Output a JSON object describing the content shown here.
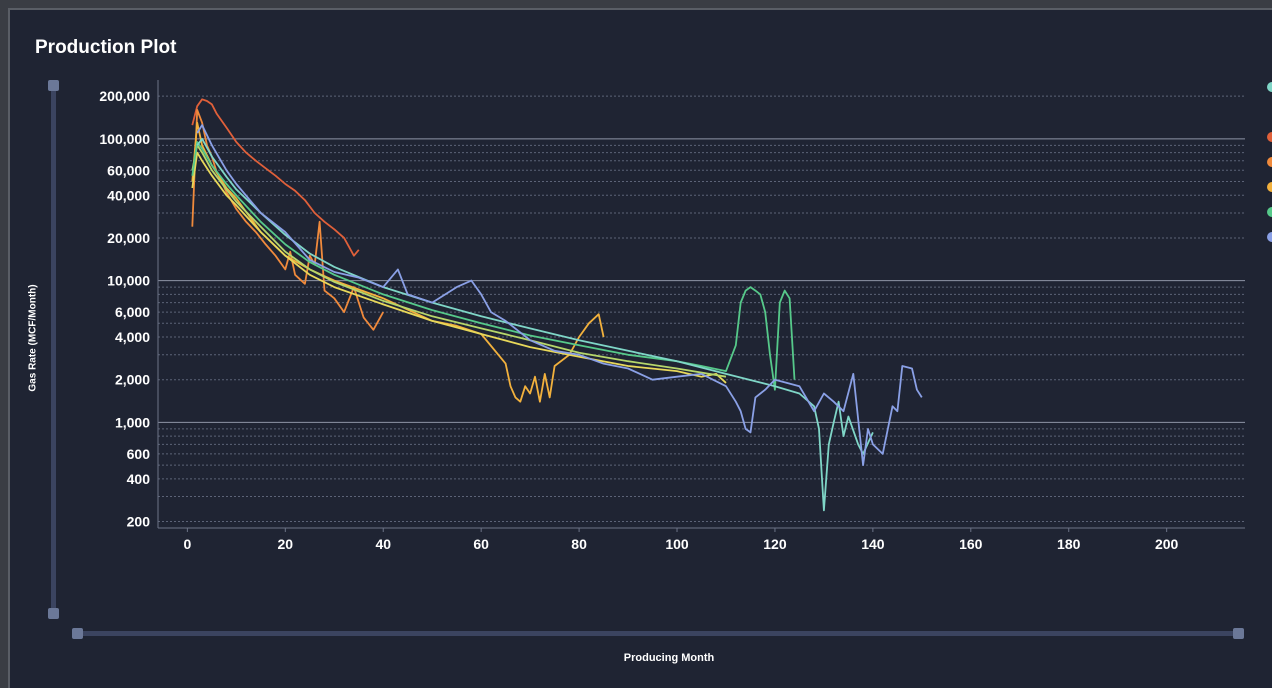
{
  "panel": {
    "title": "Production Plot"
  },
  "chart_data": {
    "type": "line",
    "title": "Production Plot",
    "xlabel": "Producing Month",
    "ylabel": "Gas Rate (MCF/Month)",
    "yscale": "log",
    "xlim": [
      -6,
      216
    ],
    "ylim": [
      180,
      260000
    ],
    "x_ticks": [
      0,
      20,
      40,
      60,
      80,
      100,
      120,
      140,
      160,
      180,
      200
    ],
    "y_ticks": [
      200,
      400,
      600,
      1000,
      2000,
      4000,
      6000,
      10000,
      20000,
      40000,
      60000,
      100000,
      200000
    ],
    "y_tick_labels": [
      "200",
      "400",
      "600",
      "1,000",
      "2,000",
      "4,000",
      "6,000",
      "10,000",
      "20,000",
      "40,000",
      "60,000",
      "100,000",
      "200,000"
    ],
    "grid": true,
    "legend_position": "right (clipped)",
    "series": [
      {
        "color": "#e0603a",
        "x": [
          1,
          2,
          3,
          4,
          5,
          6,
          8,
          10,
          12,
          14,
          16,
          18,
          20,
          22,
          24,
          26,
          28,
          30,
          32,
          34,
          35
        ],
        "y": [
          125000,
          170000,
          190000,
          185000,
          175000,
          150000,
          120000,
          95000,
          80000,
          70000,
          62000,
          55000,
          48000,
          43000,
          37000,
          30000,
          26000,
          23000,
          20000,
          15000,
          16500
        ]
      },
      {
        "color": "#f08a3c",
        "x": [
          1,
          2,
          3,
          4,
          5,
          6,
          7,
          8,
          10,
          12,
          14,
          16,
          18,
          20,
          21,
          22,
          24,
          25,
          26,
          27,
          28,
          30,
          32,
          34,
          35,
          36,
          38,
          40
        ],
        "y": [
          24000,
          160000,
          130000,
          90000,
          75000,
          58000,
          50000,
          42000,
          32000,
          26000,
          22000,
          18000,
          15000,
          12000,
          16000,
          11000,
          9500,
          15000,
          13000,
          26000,
          8500,
          7500,
          6000,
          9000,
          7000,
          5500,
          4500,
          6000
        ]
      },
      {
        "color": "#f2b13d",
        "x": [
          1,
          2,
          3,
          5,
          8,
          10,
          15,
          20,
          25,
          30,
          40,
          50,
          55,
          60,
          65,
          66,
          67,
          68,
          69,
          70,
          71,
          72,
          73,
          74,
          75,
          78,
          80,
          82,
          84,
          85
        ],
        "y": [
          50000,
          130000,
          90000,
          65000,
          45000,
          38000,
          22000,
          15000,
          12000,
          10000,
          7500,
          5200,
          4800,
          4200,
          2600,
          1800,
          1500,
          1400,
          1800,
          1600,
          2100,
          1400,
          2200,
          1500,
          2500,
          3000,
          4000,
          5000,
          5800,
          4000
        ]
      },
      {
        "color": "#e8d85a",
        "x": [
          1,
          2,
          3,
          5,
          8,
          10,
          15,
          20,
          25,
          30,
          40,
          50,
          60,
          70,
          80,
          90,
          100,
          105,
          108,
          110
        ],
        "y": [
          45000,
          80000,
          70000,
          55000,
          40000,
          34000,
          22000,
          15000,
          11000,
          9000,
          6800,
          5200,
          4200,
          3400,
          2900,
          2500,
          2300,
          2100,
          2200,
          1900
        ]
      },
      {
        "color": "#b6d66b",
        "x": [
          1,
          2,
          3,
          5,
          8,
          10,
          15,
          20,
          25,
          30,
          40,
          50,
          60,
          70,
          80,
          90,
          100,
          110
        ],
        "y": [
          60000,
          90000,
          80000,
          60000,
          44000,
          36000,
          24000,
          16000,
          12000,
          9800,
          7200,
          5600,
          4600,
          3800,
          3100,
          2700,
          2400,
          2100
        ]
      },
      {
        "color": "#56c98a",
        "x": [
          1,
          2,
          3,
          5,
          8,
          10,
          15,
          20,
          25,
          30,
          40,
          50,
          60,
          70,
          80,
          90,
          100,
          105,
          110,
          112,
          113,
          114,
          115,
          116,
          117,
          118,
          119,
          120,
          121,
          122,
          123,
          124
        ],
        "y": [
          55000,
          95000,
          85000,
          65000,
          48000,
          40000,
          26000,
          18000,
          13500,
          11000,
          8000,
          6200,
          5000,
          4100,
          3500,
          3000,
          2700,
          2500,
          2300,
          3500,
          7000,
          8500,
          9000,
          8500,
          8000,
          6000,
          3000,
          1700,
          7000,
          8500,
          7500,
          2000
        ]
      },
      {
        "color": "#7fd6c7",
        "x": [
          2,
          3,
          5,
          8,
          10,
          15,
          20,
          25,
          30,
          40,
          50,
          60,
          70,
          80,
          90,
          100,
          110,
          120,
          125,
          128,
          129,
          130,
          131,
          132,
          133,
          134,
          135,
          137,
          138,
          140
        ],
        "y": [
          90000,
          100000,
          75000,
          54000,
          44000,
          30000,
          21000,
          15500,
          12500,
          9000,
          7000,
          5600,
          4600,
          3800,
          3200,
          2700,
          2200,
          1800,
          1600,
          1300,
          900,
          240,
          700,
          1000,
          1400,
          800,
          1100,
          700,
          600,
          850
        ]
      },
      {
        "color": "#8aa0e6",
        "x": [
          2,
          3,
          5,
          8,
          10,
          15,
          20,
          25,
          30,
          35,
          40,
          43,
          45,
          50,
          55,
          58,
          60,
          62,
          65,
          70,
          75,
          80,
          85,
          90,
          95,
          100,
          105,
          110,
          112,
          113,
          114,
          115,
          116,
          118,
          120,
          125,
          128,
          130,
          132,
          134,
          136,
          138,
          139,
          140,
          142,
          144,
          145,
          146,
          148,
          149,
          150
        ],
        "y": [
          110000,
          125000,
          90000,
          60000,
          48000,
          30000,
          22000,
          14000,
          11500,
          10500,
          9000,
          12000,
          8000,
          7000,
          9000,
          10000,
          8000,
          6000,
          5200,
          3800,
          3200,
          3000,
          2600,
          2400,
          2000,
          2100,
          2200,
          1800,
          1400,
          1200,
          900,
          850,
          1500,
          1700,
          2000,
          1800,
          1200,
          1600,
          1400,
          1200,
          2200,
          500,
          900,
          700,
          600,
          1300,
          1200,
          2500,
          2400,
          1700,
          1500
        ]
      }
    ],
    "legend_colors": [
      "#7fd6c7",
      "#e0603a",
      "#f08a3c",
      "#f2b13d",
      "#56c98a",
      "#8aa0e6"
    ]
  }
}
